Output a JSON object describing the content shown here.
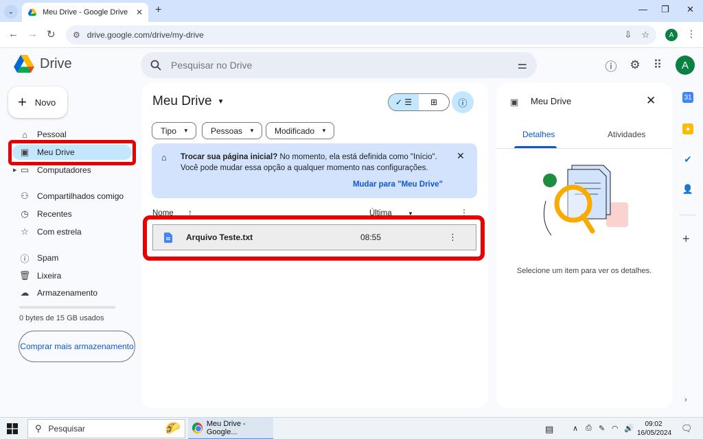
{
  "browser": {
    "tab_title": "Meu Drive - Google Drive",
    "url": "drive.google.com/drive/my-drive",
    "profile_initial": "A"
  },
  "drive": {
    "brand": "Drive",
    "search_placeholder": "Pesquisar no Drive",
    "avatar_initial": "A"
  },
  "sidebar": {
    "new_label": "Novo",
    "items": [
      {
        "label": "Pessoal",
        "icon": "home-icon"
      },
      {
        "label": "Meu Drive",
        "icon": "my-drive-icon"
      },
      {
        "label": "Computadores",
        "icon": "computer-icon"
      },
      {
        "label": "Compartilhados comigo",
        "icon": "shared-icon"
      },
      {
        "label": "Recentes",
        "icon": "clock-icon"
      },
      {
        "label": "Com estrela",
        "icon": "star-icon"
      },
      {
        "label": "Spam",
        "icon": "spam-icon"
      },
      {
        "label": "Lixeira",
        "icon": "trash-icon"
      },
      {
        "label": "Armazenamento",
        "icon": "cloud-icon"
      }
    ],
    "storage_text": "0 bytes de 15 GB usados",
    "storage_used_fraction": 0,
    "buy_storage_label": "Comprar mais armazenamento"
  },
  "main": {
    "title": "Meu Drive",
    "filters": [
      "Tipo",
      "Pessoas",
      "Modificado"
    ],
    "banner": {
      "bold": "Trocar sua página inicial?",
      "text": " No momento, ela está definida como \"Início\". Você pode mudar essa opção a qualquer momento nas configurações.",
      "action": "Mudar para \"Meu Drive\""
    },
    "columns": {
      "name": "Nome",
      "modified": "Última"
    },
    "files": [
      {
        "name": "Arquivo Teste.txt",
        "modified": "08:55",
        "icon": "doc-file-icon"
      }
    ]
  },
  "details": {
    "title": "Meu Drive",
    "tabs": [
      "Detalhes",
      "Atividades"
    ],
    "empty_text": "Selecione um item para ver os detalhes."
  },
  "taskbar": {
    "search_label": "Pesquisar",
    "app_label": "Meu Drive - Google...",
    "time": "09:02",
    "date": "16/05/2024"
  },
  "colors": {
    "accent": "#0b57d0",
    "active_nav": "#c2e7ff",
    "banner": "#d3e3fd",
    "highlight_red": "#e60000"
  }
}
